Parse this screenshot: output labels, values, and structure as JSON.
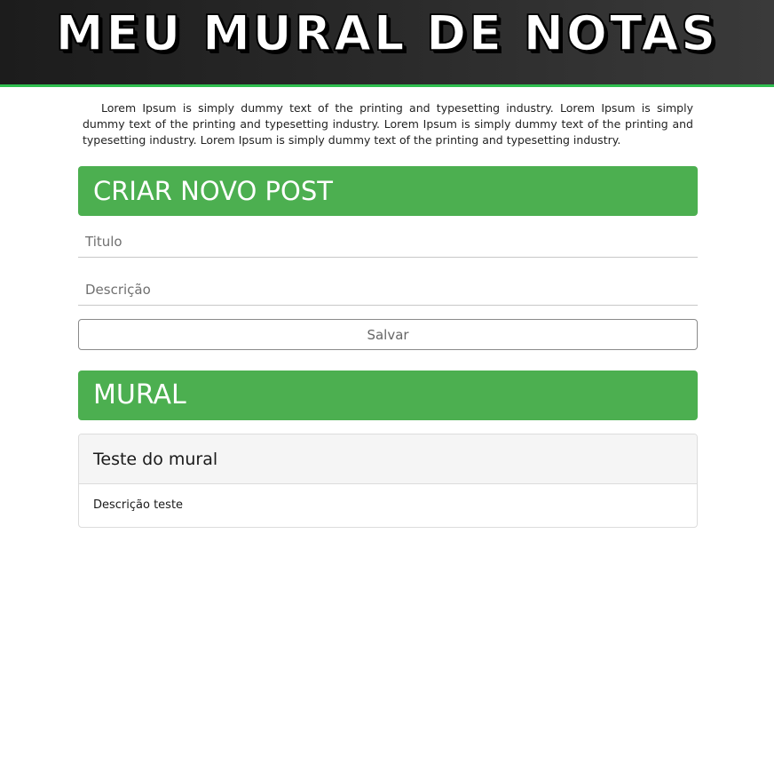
{
  "header": {
    "title": "Meu Mural de Notas"
  },
  "intro": {
    "text": "Lorem Ipsum is simply dummy text of the printing and typesetting industry. Lorem Ipsum is simply dummy text of the printing and typesetting industry. Lorem Ipsum is simply dummy text of the printing and typesetting industry. Lorem Ipsum is simply dummy text of the printing and typesetting industry."
  },
  "create_section": {
    "heading": "CRIAR NOVO POST",
    "title_field": {
      "value": "",
      "placeholder": "Titulo"
    },
    "description_field": {
      "value": "",
      "placeholder": "Descrição"
    },
    "save_label": "Salvar"
  },
  "mural_section": {
    "heading": "MURAL",
    "posts": [
      {
        "title": "Teste do mural",
        "description": "Descrição teste"
      }
    ]
  },
  "colors": {
    "accent_green": "#4caf50",
    "header_border": "#2fbf4f",
    "header_bg": "#2a2a2a"
  }
}
